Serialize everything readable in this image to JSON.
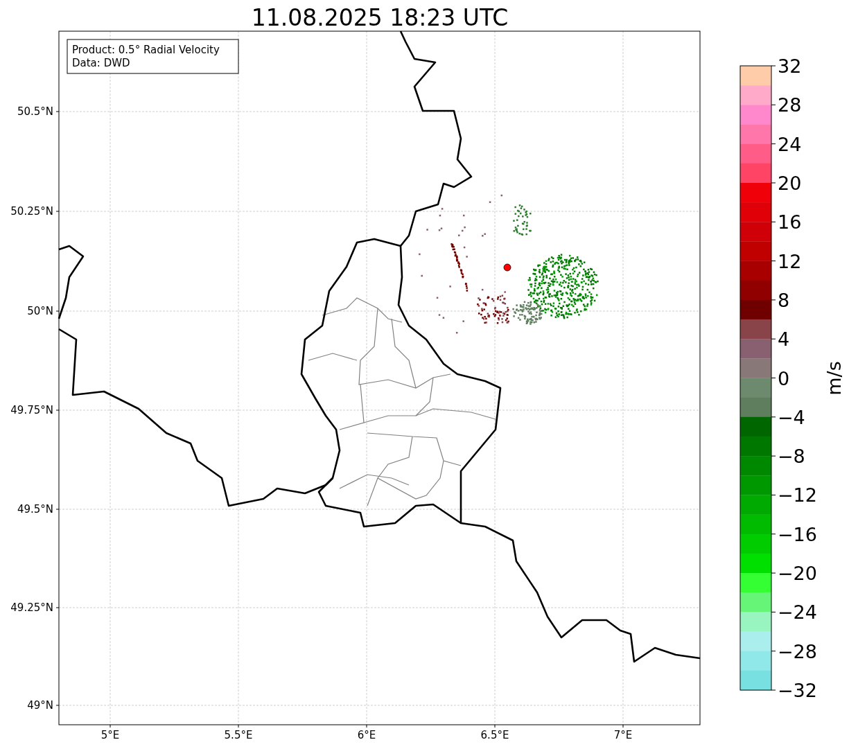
{
  "title": "11.08.2025 18:23 UTC",
  "info_box": {
    "lines": [
      "Product: 0.5° Radial Velocity",
      "Data: DWD"
    ]
  },
  "x_axis": {
    "ticks": [
      "5°E",
      "5.5°E",
      "6°E",
      "6.5°E",
      "7°E"
    ]
  },
  "y_axis": {
    "ticks": [
      "50.5°N",
      "50.25°N",
      "50°N",
      "49.75°N",
      "49.5°N",
      "49.25°N",
      "49°N"
    ]
  },
  "colorbar": {
    "label": "m/s",
    "ticks": [
      "32",
      "28",
      "24",
      "20",
      "16",
      "12",
      "8",
      "4",
      "0",
      "−4",
      "−8",
      "−12",
      "−16",
      "−20",
      "−24",
      "−28",
      "−32"
    ],
    "bands": [
      {
        "color": "#ffccaa"
      },
      {
        "color": "#ffaac8"
      },
      {
        "color": "#ff88cc"
      },
      {
        "color": "#ff77aa"
      },
      {
        "color": "#ff5c88"
      },
      {
        "color": "#ff4466"
      },
      {
        "color": "#f00008"
      },
      {
        "color": "#e00008"
      },
      {
        "color": "#d00008"
      },
      {
        "color": "#c00000"
      },
      {
        "color": "#a80000"
      },
      {
        "color": "#900000"
      },
      {
        "color": "#700000"
      },
      {
        "color": "#884448"
      },
      {
        "color": "#886070"
      },
      {
        "color": "#887878"
      },
      {
        "color": "#6e8a6e"
      },
      {
        "color": "#5e7e5e"
      },
      {
        "color": "#006600"
      },
      {
        "color": "#007800"
      },
      {
        "color": "#008800"
      },
      {
        "color": "#009800"
      },
      {
        "color": "#00aa00"
      },
      {
        "color": "#00bb00"
      },
      {
        "color": "#00cc00"
      },
      {
        "color": "#00e000"
      },
      {
        "color": "#33ff33"
      },
      {
        "color": "#66f577"
      },
      {
        "color": "#99f5c0"
      },
      {
        "color": "#aaeeee"
      },
      {
        "color": "#90e8e8"
      },
      {
        "color": "#78e0e0"
      }
    ]
  }
}
